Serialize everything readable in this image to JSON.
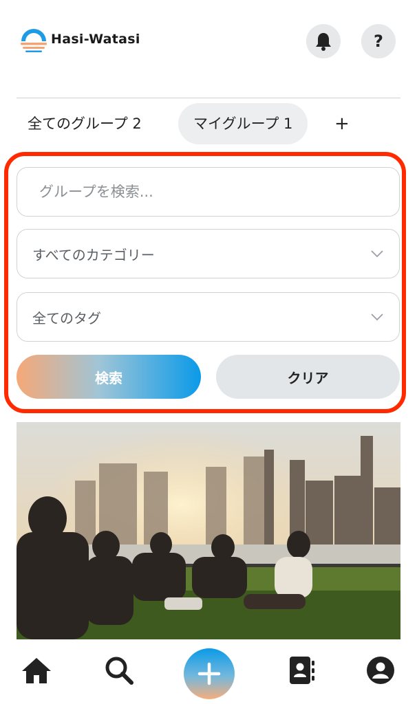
{
  "app": {
    "brand": "Hasi-Watasi"
  },
  "header": {
    "help_label": "?"
  },
  "tabs": [
    {
      "label": "全てのグループ 2"
    },
    {
      "label": "マイグループ 1"
    },
    {
      "label": "+"
    }
  ],
  "filters": {
    "search_placeholder": "グループを検索...",
    "search_value": "",
    "category_selected": "すべてのカテゴリー",
    "tag_selected": "全てのタグ",
    "search_button": "検索",
    "clear_button": "クリア"
  },
  "colors": {
    "highlight_border": "#ff2a00",
    "accent_blue": "#0b9ae8",
    "accent_peach": "#f6a877",
    "chip_bg": "#eceeef"
  },
  "icons": {
    "bell": "bell-icon",
    "help": "question-icon",
    "chevron": "chevron-down-icon",
    "home": "home-icon",
    "search": "search-icon",
    "add": "plus-icon",
    "contacts": "contacts-book-icon",
    "profile": "user-icon"
  }
}
